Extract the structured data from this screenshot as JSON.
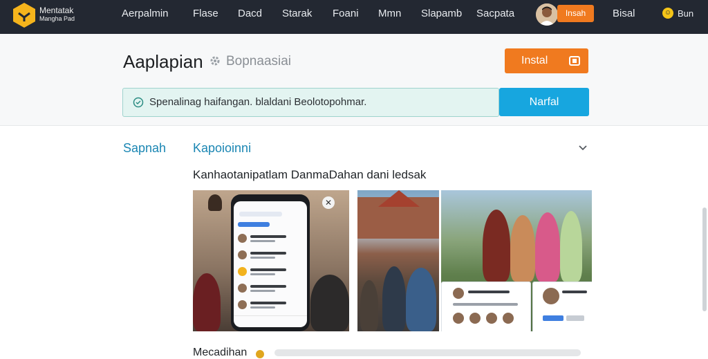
{
  "topbar": {
    "brand_line1": "Mentatak",
    "brand_line2": "Mangha Pad",
    "nav": [
      "Aerpalmin",
      "Flase",
      "Dacd",
      "Starak",
      "Foani",
      "Mmn",
      "Slapamb",
      "Sacpata"
    ],
    "install_label": "Insah",
    "bisal_label": "Bisal",
    "user_label": "Bun"
  },
  "header": {
    "title": "Aaplapian",
    "subtitle": "Bopnaasiai",
    "install_button": "Instal",
    "notice_text": "Spenalinag haifangan. blaldani Beolotopohmar.",
    "blue_button": "Narfal"
  },
  "content": {
    "side_link": "Sapnah",
    "tab_label": "Kapoioinni",
    "description": "Kanhaotanipatlam DanmaDahan dani ledsak",
    "footer_title": "Mecadihan"
  },
  "colors": {
    "topbar": "#232832",
    "accent_orange": "#f07a1f",
    "accent_blue": "#17a6df",
    "link": "#1a86b3"
  }
}
